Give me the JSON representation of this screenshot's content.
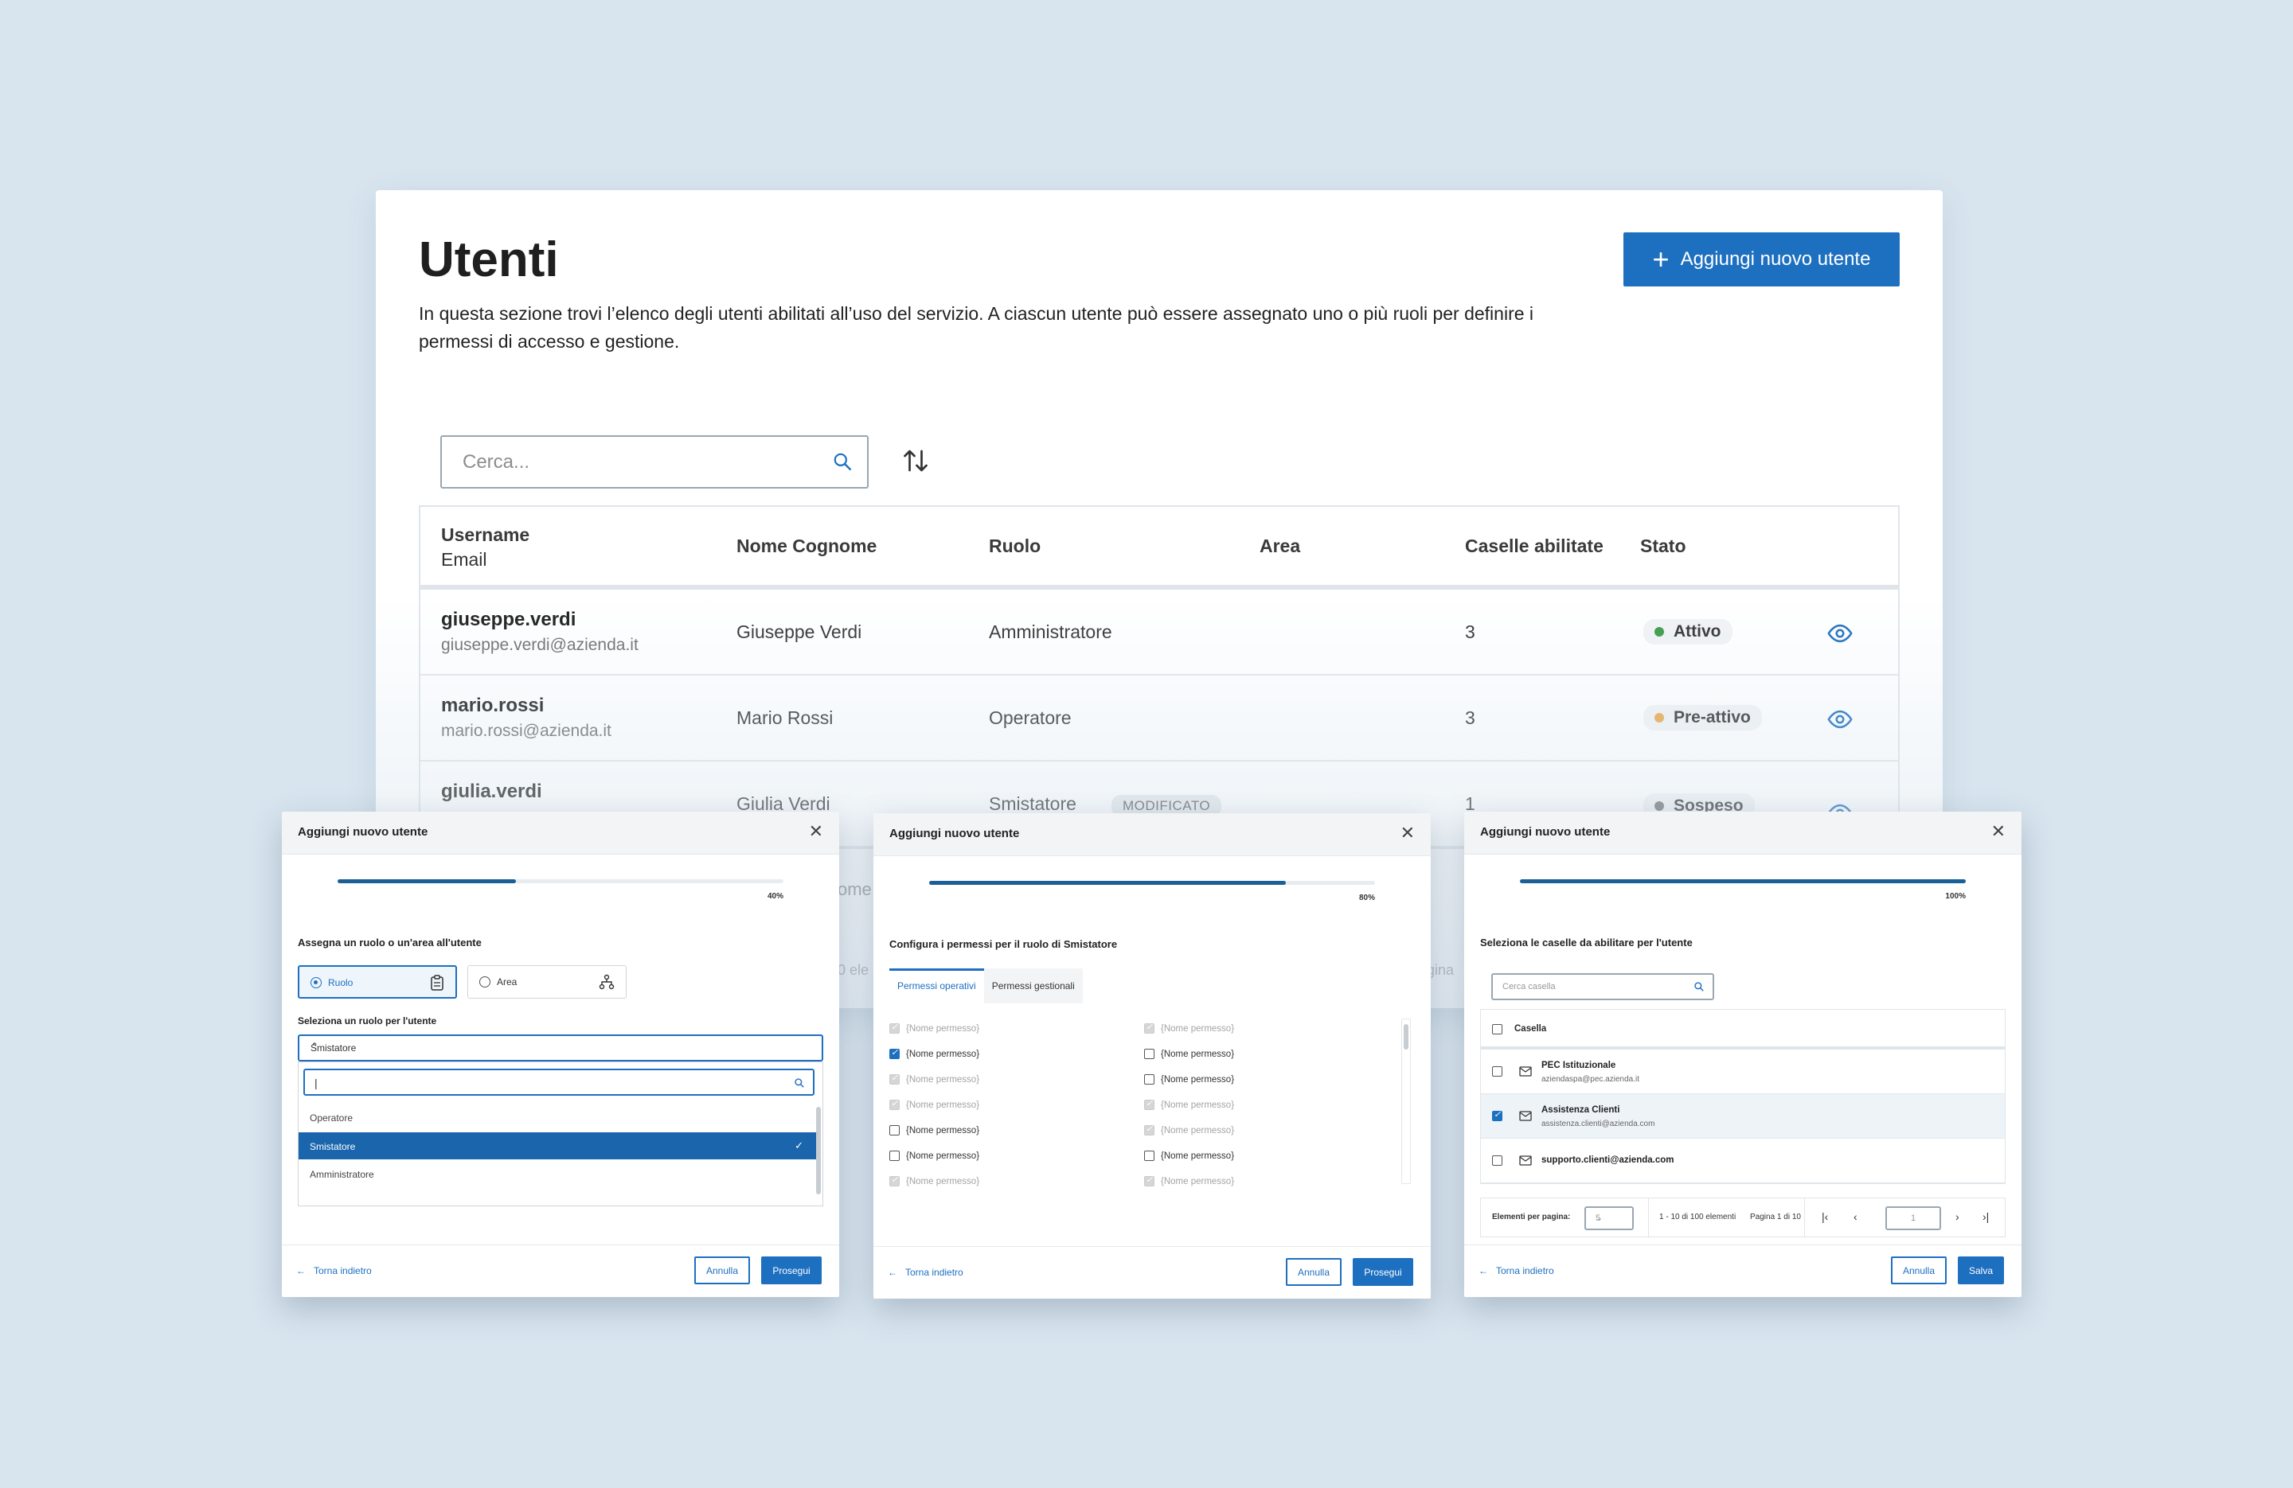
{
  "page": {
    "title": "Utenti",
    "description": "In questa sezione trovi l’elenco degli utenti abilitati all’uso del servizio. A ciascun utente può essere assegnato uno o più ruoli per definire i permessi di accesso e gestione.",
    "add_button_label": "Aggiungi nuovo utente"
  },
  "search": {
    "placeholder": "Cerca..."
  },
  "table": {
    "headers": {
      "username": "Username",
      "email": "Email",
      "name": "Nome Cognome",
      "role": "Ruolo",
      "area": "Area",
      "mailboxes": "Caselle abilitate",
      "status": "Stato"
    },
    "rows": [
      {
        "username": "giuseppe.verdi",
        "email": "giuseppe.verdi@azienda.it",
        "name": "Giuseppe Verdi",
        "role": "Amministratore",
        "mailboxes": "3",
        "status": "Attivo",
        "status_color": "#3a9a4a"
      },
      {
        "username": "mario.rossi",
        "email": "mario.rossi@azienda.it",
        "name": "Mario Rossi",
        "role": "Operatore",
        "mailboxes": "3",
        "status": "Pre-attivo",
        "status_color": "#e8a94a"
      },
      {
        "username": "giulia.verdi",
        "email": "",
        "name": "Giulia Verdi",
        "role": "Smistatore",
        "badge": "MODIFICATO",
        "mailboxes": "1",
        "status": "Sospeso",
        "status_color": "#6f6f6f"
      }
    ],
    "partial_texts": {
      "a": "ome",
      "b": "0 ele",
      "c": "gina"
    }
  },
  "modal1": {
    "title": "Aggiungi nuovo utente",
    "progress_pct": 40,
    "progress_label": "40%",
    "prompt": "Assegna un ruolo o un'area all'utente",
    "option_role": "Ruolo",
    "option_area": "Area",
    "select_label": "Seleziona un ruolo per l'utente",
    "select_value": "Smistatore",
    "search_value": "|",
    "options": [
      "Operatore",
      "Smistatore",
      "Amministratore"
    ],
    "back": "Torna indietro",
    "cancel": "Annulla",
    "next": "Prosegui"
  },
  "modal2": {
    "title": "Aggiungi nuovo utente",
    "progress_pct": 80,
    "progress_label": "80%",
    "prompt": "Configura i permessi per il ruolo di Smistatore",
    "tabs": [
      "Permessi operativi",
      "Permessi gestionali"
    ],
    "permission_label": "{Nome permesso}",
    "left_states": [
      "dis",
      "on",
      "dis",
      "dis",
      "off",
      "off",
      "dis"
    ],
    "right_states": [
      "dis",
      "off",
      "off",
      "dis",
      "dis",
      "off",
      "dis"
    ],
    "back": "Torna indietro",
    "cancel": "Annulla",
    "next": "Prosegui"
  },
  "modal3": {
    "title": "Aggiungi nuovo utente",
    "progress_pct": 100,
    "progress_label": "100%",
    "prompt": "Seleziona le caselle da abilitare per l'utente",
    "search_placeholder": "Cerca casella",
    "column": "Casella",
    "rows": [
      {
        "name": "PEC Istituzionale",
        "email": "aziendaspa@pec.azienda.it",
        "checked": false
      },
      {
        "name": "Assistenza Clienti",
        "email": "assistenza.clienti@azienda.com",
        "checked": true
      },
      {
        "name": "supporto.clienti@azienda.com",
        "email": "",
        "checked": false
      }
    ],
    "per_page_label": "Elementi per pagina:",
    "per_page_value": "5",
    "range": "1 - 10 di 100 elementi",
    "page_info": "Pagina 1 di 10",
    "page_input": "1",
    "back": "Torna indietro",
    "cancel": "Annulla",
    "save": "Salva"
  },
  "colors": {
    "accent": "#1d6fc0",
    "background": "#d8e5ef"
  }
}
